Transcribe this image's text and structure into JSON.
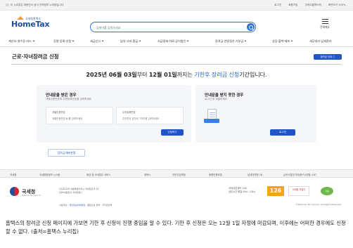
{
  "topbar": {
    "gov_notice": "이 누리집은 대한민국 공식 전자정부 누리집입니다.",
    "links": [
      "로그인",
      "회원가입",
      "주바이홈택스에",
      "화면크기 100% -"
    ]
  },
  "header": {
    "logo_small": "국세청홈택스",
    "logo_big": "HomeTax",
    "search_placeholder": "검색어를 입력하세요",
    "menu_label": "전체메뉴"
  },
  "nav": {
    "items": [
      "계산서·영수증·카드",
      "증명·등록·신청",
      "세금신고",
      "납부·고지·환급",
      "지급명세·자료·공익법인",
      "장려금·연말정산·기부금",
      "상담·불복·제보",
      "세무대리·납세관리"
    ]
  },
  "page": {
    "title": "근로·자녀장려금 신청",
    "chip": "장려금 안내 ⓘ"
  },
  "period": {
    "start": "2025년 06월 03일",
    "mid": "부터 ",
    "end": "12월 01일",
    "mid2": "까지는 ",
    "highlight": "기한후 장려금 신청",
    "tail": "기간입니다."
  },
  "left_panel": {
    "heading": "안내문을 받은 경우",
    "sub": "개별인증번호와 주민등록번호를 입력하세요",
    "field1_label": "개별인증번호",
    "field1_placeholder": "개별인증번호(8)를 입력하세요",
    "field2_label": "주민등록번호",
    "field2_placeholder": "주민번호 앞자리 7자리를 입력하세요",
    "button": "신청하기"
  },
  "right_panel": {
    "heading": "안내문을 받지 못한 경우",
    "sub": "로그인 후 제출하세요",
    "button": "로그인"
  },
  "guide_button": "장려금 예비판정",
  "footer": {
    "nav": [
      "국세청",
      "국세법령정보 시스템",
      "현금 및 국세업무 서비스",
      "위택스",
      "국민건강보험",
      "종합민원포털",
      "납세자연맹 26",
      "손탄사업연기타(청구)(지원) 167"
    ],
    "nts_name": "국세청",
    "nts_sub": "National Tax Service",
    "address_lines": [
      "(우)30128 세종특별자치시 국세청로 8-14",
      "(정부세종청사 국세청동)"
    ],
    "call_lines": [
      "국세상담센터 126",
      "상담시간 평일 09시 - 18시"
    ],
    "number": "126",
    "logo_b": "국세청 지킴이",
    "logo_c": "인증",
    "policy": [
      "이용약관",
      "개인정보처리방침",
      "웹접근성 정책",
      "저작권정책"
    ],
    "copyright": "©National Tax Service. All Rights Reserved."
  },
  "caption": "홈택스의 장려금 신청 페이지에 가보면 기한 후 신청이 진행 중임을 알 수 있다. 기한 후 신청은 오는 12월 1일 자정에 마감되며, 이후에는 어떠한 경우에도 신청할 수 없다. (출처=홈택스 누리집)",
  "colors": {
    "brand_blue": "#1f55c6",
    "highlight_blue": "#1f66d6",
    "logo_orange": "#f29a1f"
  }
}
